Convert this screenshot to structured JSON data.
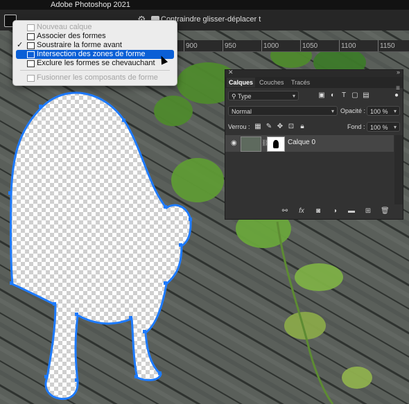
{
  "app": {
    "title": "Adobe Photoshop 2021"
  },
  "options_bar": {
    "constrain_label": "Contraindre glisser-déplacer t"
  },
  "ruler": {
    "ticks": [
      "900",
      "950",
      "1000",
      "1050",
      "1100",
      "1150"
    ]
  },
  "context_menu": {
    "items": [
      {
        "label": "Nouveau calque",
        "checked": false,
        "disabled": true,
        "selected": false
      },
      {
        "label": "Associer des formes",
        "checked": false,
        "disabled": false,
        "selected": false
      },
      {
        "label": "Soustraire la forme avant",
        "checked": true,
        "disabled": false,
        "selected": false
      },
      {
        "label": "Intersection des zones de forme",
        "checked": false,
        "disabled": false,
        "selected": true
      },
      {
        "label": "Exclure les formes se chevauchant",
        "checked": false,
        "disabled": false,
        "selected": false
      },
      {
        "label": "Fusionner les composants de forme",
        "checked": false,
        "disabled": true,
        "selected": false
      }
    ]
  },
  "layers_panel": {
    "tabs": [
      "Calques",
      "Couches",
      "Tracés"
    ],
    "active_tab": "Calques",
    "filter_label": "Type",
    "blend_mode": "Normal",
    "opacity_label": "Opacité :",
    "opacity_value": "100 %",
    "lock_label": "Verrou :",
    "fill_label": "Fond :",
    "fill_value": "100 %",
    "layer_name": "Calque 0",
    "bottom_icons": [
      "link-icon",
      "fx-icon",
      "mask-icon",
      "adjustment-icon",
      "group-icon",
      "new-layer-icon",
      "trash-icon"
    ],
    "fx_text": "fx"
  },
  "colors": {
    "menu_highlight": "#0a5fd6",
    "path_outline": "#1e7bff",
    "panel_bg": "#323232"
  }
}
